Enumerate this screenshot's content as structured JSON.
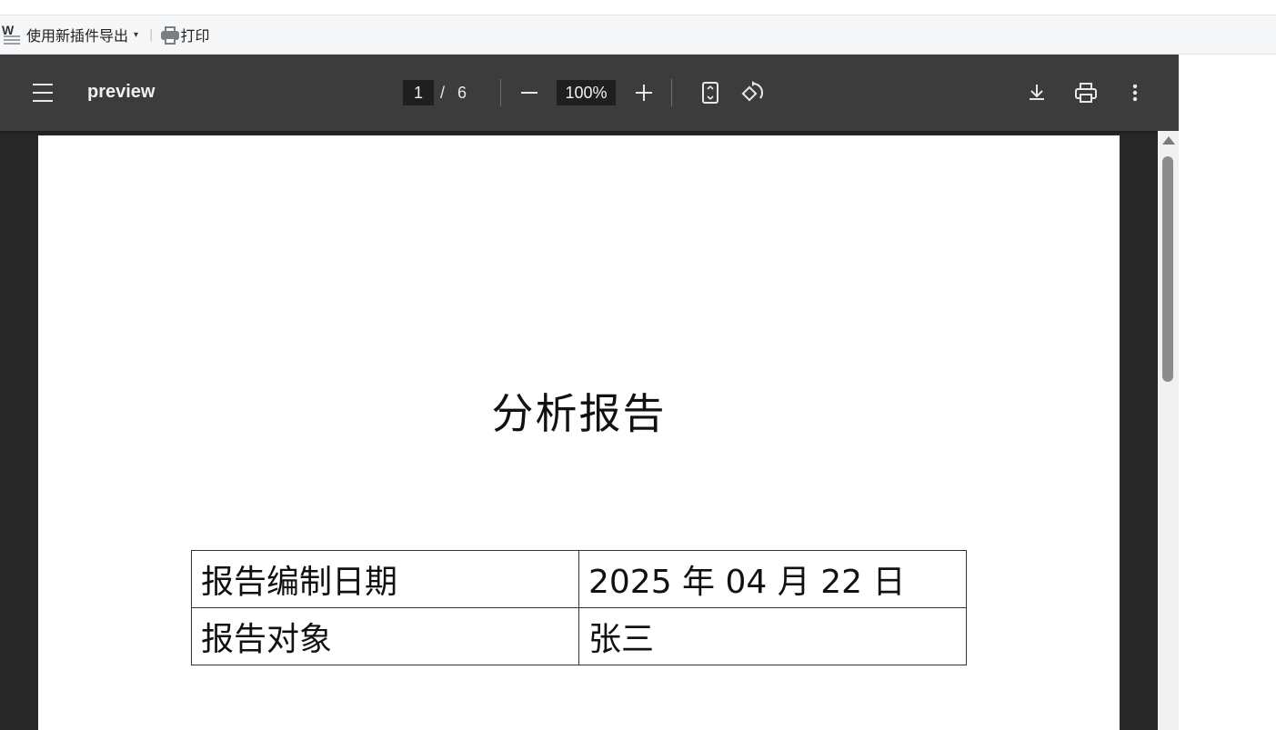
{
  "browser_toolbar": {
    "export_label": "使用新插件导出",
    "export_icon": "word-doc-icon",
    "caret": "▾",
    "separator": "|",
    "print_label": "打印",
    "print_icon": "printer-icon"
  },
  "viewer": {
    "title": "preview",
    "current_page": "1",
    "page_separator": "/",
    "total_pages": "6",
    "zoom": "100%",
    "icons": [
      "menu-icon",
      "zoom-out-icon",
      "zoom-in-icon",
      "fit-page-icon",
      "rotate-icon",
      "download-icon",
      "print-icon",
      "more-options-icon"
    ]
  },
  "document": {
    "title": "分析报告",
    "table": [
      {
        "label": "报告编制日期",
        "value": "2025 年 04 月 22 日"
      },
      {
        "label": "报告对象",
        "value": "张三"
      }
    ]
  },
  "colors": {
    "viewer_bar": "#3c3c3c",
    "viewer_bg": "#282828",
    "page": "#ffffff"
  }
}
